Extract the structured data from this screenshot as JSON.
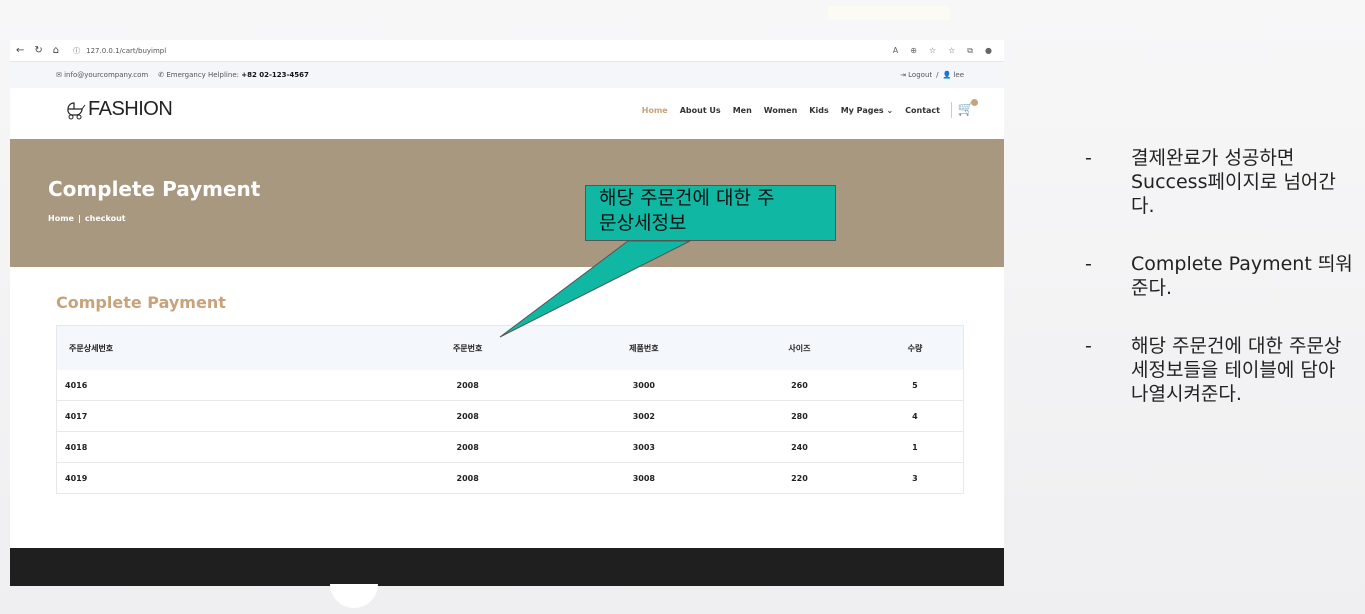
{
  "browser": {
    "url": "127.0.0.1/cart/buyimpl"
  },
  "topbar": {
    "email": "info@yourcompany.com",
    "helpline_label": "Emergancy Helpline:",
    "helpline_number": "+82 02-123-4567",
    "logout": "Logout",
    "separator": "/",
    "user": "lee"
  },
  "header": {
    "logo": "FASHION",
    "menu": [
      "Home",
      "About Us",
      "Men",
      "Women",
      "Kids",
      "My Pages",
      "Contact"
    ]
  },
  "banner": {
    "title": "Complete Payment",
    "crumb_home": "Home",
    "crumb_sep": "|",
    "crumb_current": "checkout"
  },
  "content": {
    "title": "Complete Payment",
    "table": {
      "headers": [
        "주문상세번호",
        "주문번호",
        "제품번호",
        "사이즈",
        "수량"
      ],
      "rows": [
        [
          "4016",
          "2008",
          "3000",
          "260",
          "5"
        ],
        [
          "4017",
          "2008",
          "3002",
          "280",
          "4"
        ],
        [
          "4018",
          "2008",
          "3003",
          "240",
          "1"
        ],
        [
          "4019",
          "2008",
          "3008",
          "220",
          "3"
        ]
      ]
    }
  },
  "callout": {
    "line1": "해당 주문건에 대한 주",
    "line2": "문상세정보"
  },
  "notes": [
    {
      "dash": "-",
      "text": "결제완료가 성공하면 Success페이지로 넘어간다."
    },
    {
      "dash": "-",
      "text": " Complete Payment 띄워준다."
    },
    {
      "dash": "-",
      "text": " 해당 주문건에 대한 주문상세정보들을 테이블에 담아 나열시켜준다."
    }
  ],
  "colors": {
    "accent": "#c8a27a",
    "banner": "#a7987f",
    "callout": "#10b7a2",
    "footer": "#1f1f1f"
  }
}
